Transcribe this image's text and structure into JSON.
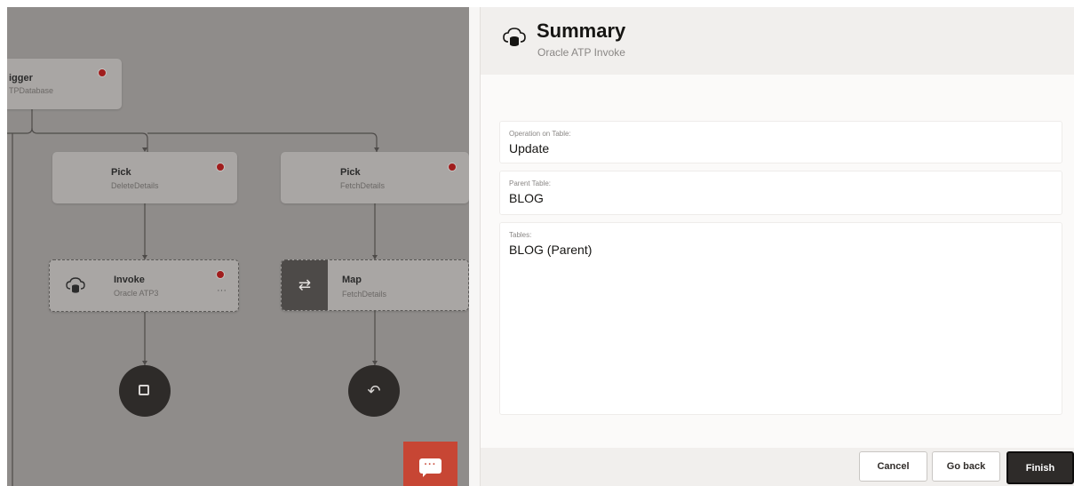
{
  "canvas": {
    "trigger": {
      "title": "igger",
      "subtitle": "TPDatabase"
    },
    "pick_left": {
      "title": "Pick",
      "subtitle": "DeleteDetails"
    },
    "pick_right": {
      "title": "Pick",
      "subtitle": "FetchDetails"
    },
    "invoke": {
      "title": "Invoke",
      "subtitle": "Oracle ATP3",
      "more": "···"
    },
    "map": {
      "title": "Map",
      "subtitle": "FetchDetails",
      "icon": "⇄"
    },
    "stop_icon": "stop-square-icon",
    "return_icon": "↶",
    "chat_dots": "···"
  },
  "panel": {
    "title": "Summary",
    "subtitle": "Oracle ATP Invoke",
    "fields": [
      {
        "label": "Operation on Table:",
        "value": "Update"
      },
      {
        "label": "Parent Table:",
        "value": "BLOG"
      },
      {
        "label": "Tables:",
        "value": "BLOG (Parent)"
      }
    ],
    "buttons": {
      "cancel": "Cancel",
      "go_back": "Go back",
      "finish": "Finish"
    }
  },
  "colors": {
    "canvas_bg": "#8f8c8a",
    "node_bg": "#a9a6a4",
    "error_dot": "#a01d1d",
    "dark_circle": "#2e2b29",
    "chat_button": "#c74634",
    "finish_button": "#2e2b29"
  }
}
